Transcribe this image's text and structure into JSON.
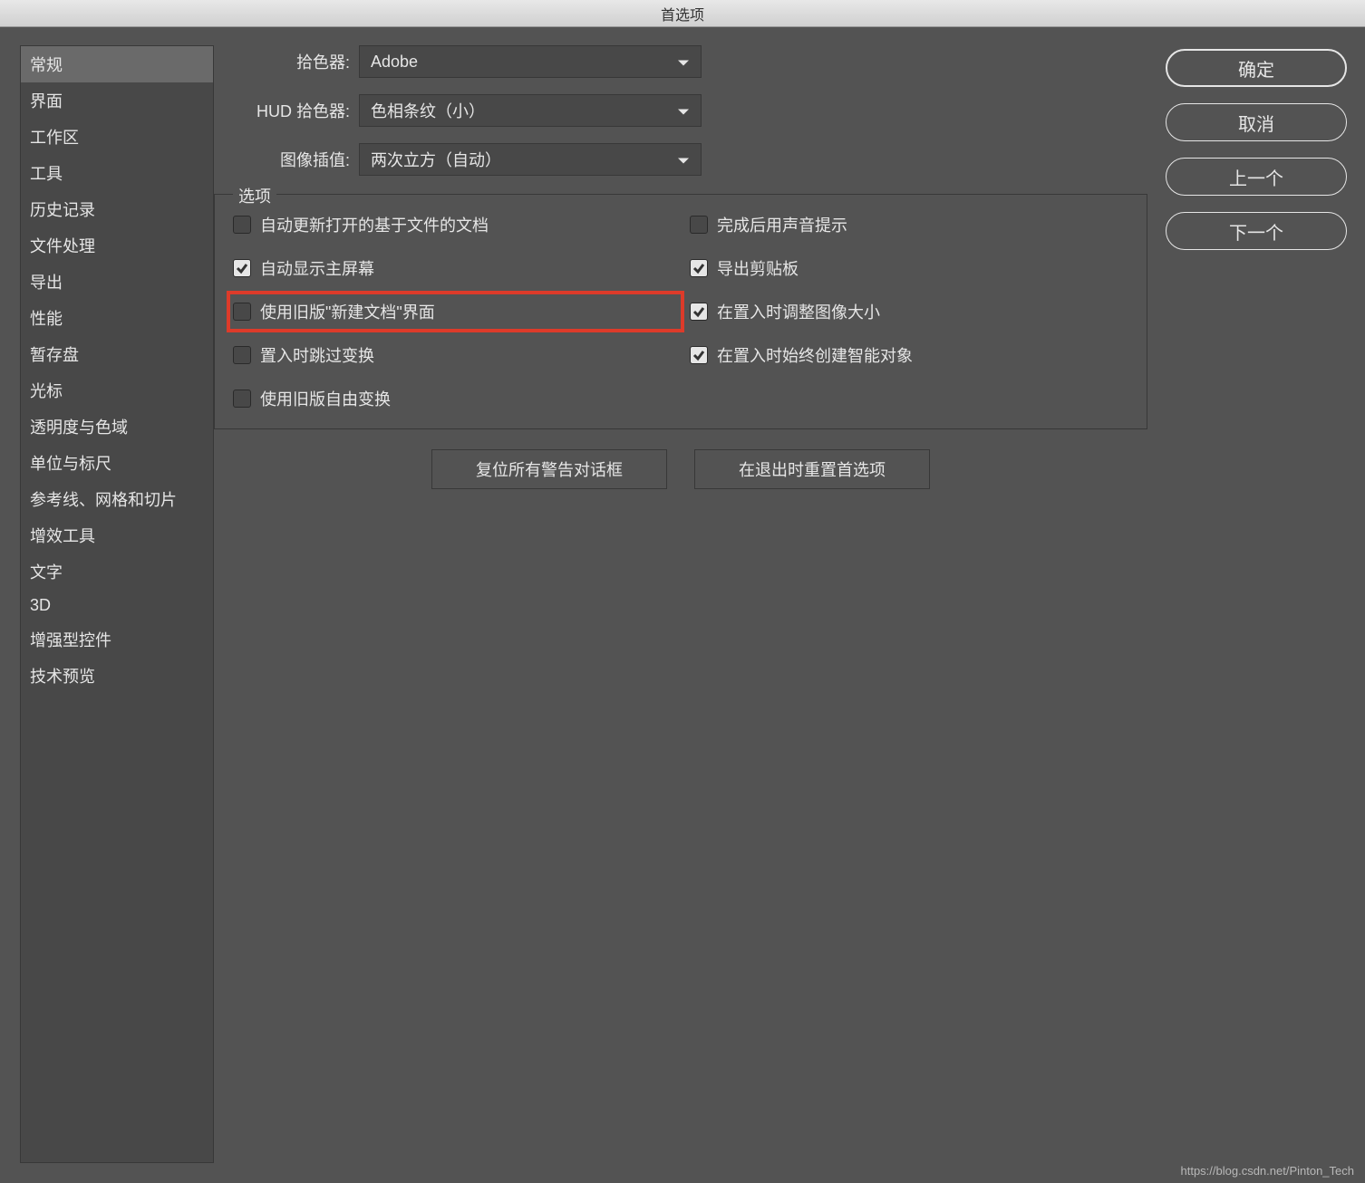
{
  "window": {
    "title": "首选项"
  },
  "sidebar": {
    "items": [
      "常规",
      "界面",
      "工作区",
      "工具",
      "历史记录",
      "文件处理",
      "导出",
      "性能",
      "暂存盘",
      "光标",
      "透明度与色域",
      "单位与标尺",
      "参考线、网格和切片",
      "增效工具",
      "文字",
      "3D",
      "增强型控件",
      "技术预览"
    ],
    "selected_index": 0
  },
  "form": {
    "color_picker": {
      "label": "拾色器:",
      "value": "Adobe"
    },
    "hud_picker": {
      "label": "HUD 拾色器:",
      "value": "色相条纹（小）"
    },
    "image_interp": {
      "label": "图像插值:",
      "value": "两次立方（自动）"
    }
  },
  "options": {
    "legend": "选项",
    "cb": {
      "auto_update": {
        "label": "自动更新打开的基于文件的文档",
        "checked": false
      },
      "beep_done": {
        "label": "完成后用声音提示",
        "checked": false
      },
      "show_home": {
        "label": "自动显示主屏幕",
        "checked": true
      },
      "export_clip": {
        "label": "导出剪贴板",
        "checked": true
      },
      "legacy_newdoc": {
        "label": "使用旧版\"新建文档\"界面",
        "checked": false
      },
      "resize_place": {
        "label": "在置入时调整图像大小",
        "checked": true
      },
      "skip_transform": {
        "label": "置入时跳过变换",
        "checked": false
      },
      "smart_object": {
        "label": "在置入时始终创建智能对象",
        "checked": true
      },
      "legacy_transform": {
        "label": "使用旧版自由变换",
        "checked": false
      }
    }
  },
  "buttons": {
    "reset_dialogs": "复位所有警告对话框",
    "reset_on_quit": "在退出时重置首选项",
    "ok": "确定",
    "cancel": "取消",
    "prev": "上一个",
    "next": "下一个"
  },
  "watermark": "https://blog.csdn.net/Pinton_Tech"
}
